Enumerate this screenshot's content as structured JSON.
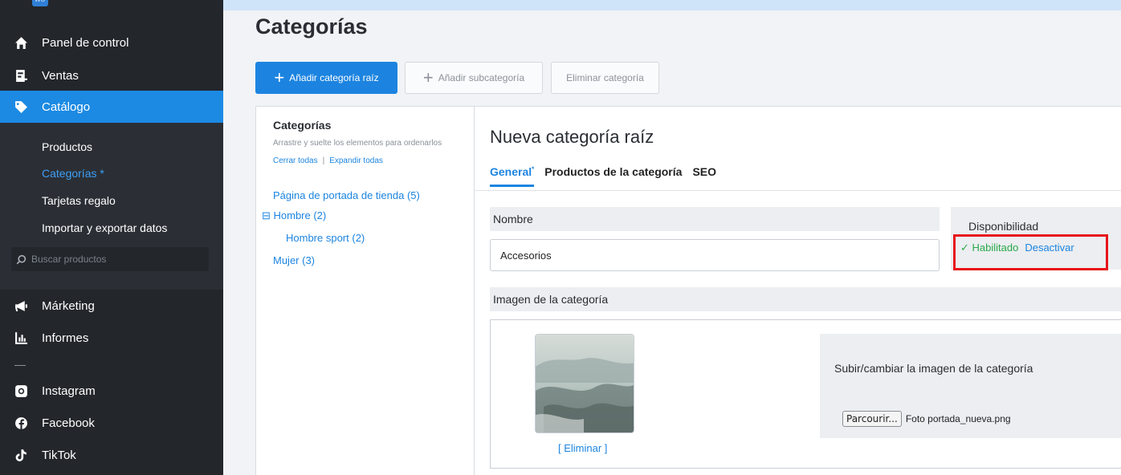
{
  "sidebar": {
    "logo_text": "wo",
    "items": [
      {
        "label": "Panel de control",
        "icon": "home-icon"
      },
      {
        "label": "Ventas",
        "icon": "sales-icon"
      },
      {
        "label": "Catálogo",
        "icon": "tag-icon"
      },
      {
        "label": "Márketing",
        "icon": "megaphone-icon"
      },
      {
        "label": "Informes",
        "icon": "chart-icon"
      },
      {
        "label": "Instagram",
        "icon": "instagram-icon"
      },
      {
        "label": "Facebook",
        "icon": "facebook-icon"
      },
      {
        "label": "TikTok",
        "icon": "tiktok-icon"
      }
    ],
    "catalog_sub": [
      {
        "label": "Productos"
      },
      {
        "label": "Categorías *"
      },
      {
        "label": "Tarjetas regalo"
      },
      {
        "label": "Importar y exportar datos"
      }
    ],
    "search_placeholder": "Buscar productos"
  },
  "page": {
    "title": "Categorías"
  },
  "toolbar": {
    "add_root_label": "Añadir categoría raíz",
    "add_sub_label": "Añadir subcategoría",
    "delete_label": "Eliminar categoría"
  },
  "tree": {
    "title": "Categorías",
    "hint": "Arrastre y suelte los elementos para ordenarlos",
    "collapse_all": "Cerrar todas",
    "separator": "|",
    "expand_all": "Expandir todas",
    "nodes": [
      {
        "label": "Página de portada de tienda (5)"
      },
      {
        "label": "⊟ Hombre (2)"
      },
      {
        "label": "Hombre sport (2)"
      },
      {
        "label": "Mujer (3)"
      }
    ]
  },
  "editor": {
    "title": "Nueva categoría raíz",
    "tabs": [
      {
        "label": "General",
        "marker": "*"
      },
      {
        "label": "Productos de la categoría"
      },
      {
        "label": "SEO"
      }
    ],
    "name_label": "Nombre",
    "name_value": "Accesorios",
    "availability": {
      "title": "Disponibilidad",
      "status": "✓ Habilitado",
      "action": "Desactivar"
    },
    "image_label": "Imagen de la categoría",
    "delete_image": "[ Eliminar ]",
    "upload_title": "Subir/cambiar la imagen de la categoría",
    "file_button": "Parcourir...",
    "file_name": "Foto portada_nueva.png"
  },
  "colors": {
    "accent": "#1c84e0",
    "sidebar_bg": "#23262b",
    "success": "#2aa84a",
    "highlight": "#e8141b"
  }
}
